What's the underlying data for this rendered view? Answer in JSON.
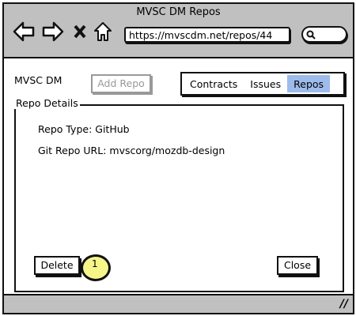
{
  "window": {
    "title": "MVSC DM Repos",
    "url": "https://mvscdm.net/repos/44"
  },
  "icons": [
    "back-arrow-icon",
    "forward-arrow-icon",
    "stop-x-icon",
    "home-icon",
    "search-icon",
    "resize-grip-icon"
  ],
  "header": {
    "brand": "MVSC DM",
    "add_repo_label": "Add Repo",
    "tabs": [
      {
        "label": "Contracts"
      },
      {
        "label": "Issues"
      },
      {
        "label": "Repos",
        "active": true
      }
    ]
  },
  "panel": {
    "legend": "Repo Details",
    "repo_type": "Repo Type: GitHub",
    "git_url": "Git Repo URL: mvscorg/mozdb-design"
  },
  "buttons": {
    "delete": "Delete",
    "close": "Close"
  },
  "badge": "1",
  "colors": {
    "titlebar": "#c0c0c0",
    "active_tab": "#9dbcec",
    "badge": "#f5f58a"
  }
}
